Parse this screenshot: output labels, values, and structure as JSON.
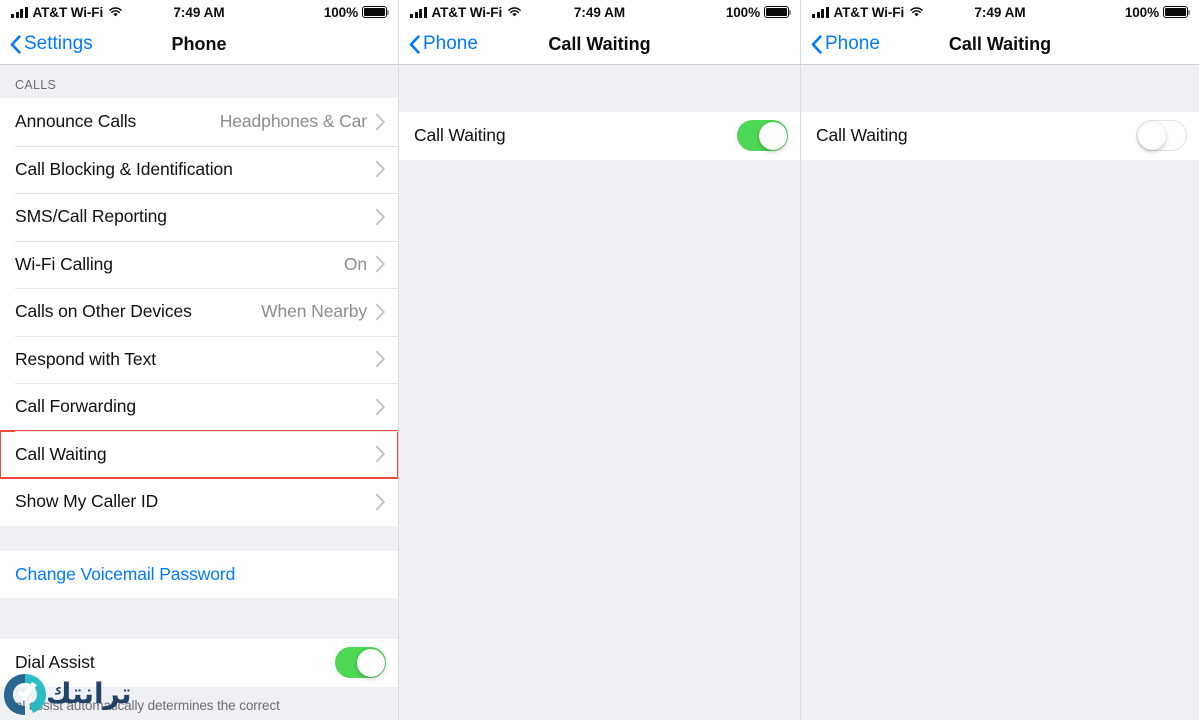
{
  "statusbar": {
    "carrier": "AT&T Wi-Fi",
    "time": "7:49 AM",
    "battery_percent": "100%",
    "signal_icon": "cellular-bars-icon",
    "wifi_icon": "wifi-icon",
    "battery_icon": "battery-full-icon"
  },
  "colors": {
    "accent_blue": "#007aff",
    "toggle_on_green": "#4cd755",
    "highlight_red": "#f04a3c",
    "value_gray": "#8c8c91",
    "group_bg": "#eff0f4"
  },
  "panel1": {
    "nav": {
      "back_label": "Settings",
      "title": "Phone",
      "back_icon": "chevron-left-icon"
    },
    "group_calls": {
      "header": "CALLS",
      "rows": [
        {
          "label": "Announce Calls",
          "value": "Headphones & Car",
          "accessory": "chevron-right-icon",
          "highlight": false
        },
        {
          "label": "Call Blocking & Identification",
          "value": "",
          "accessory": "chevron-right-icon",
          "highlight": false
        },
        {
          "label": "SMS/Call Reporting",
          "value": "",
          "accessory": "chevron-right-icon",
          "highlight": false
        },
        {
          "label": "Wi-Fi Calling",
          "value": "On",
          "accessory": "chevron-right-icon",
          "highlight": false
        },
        {
          "label": "Calls on Other Devices",
          "value": "When Nearby",
          "accessory": "chevron-right-icon",
          "highlight": false
        },
        {
          "label": "Respond with Text",
          "value": "",
          "accessory": "chevron-right-icon",
          "highlight": false
        },
        {
          "label": "Call Forwarding",
          "value": "",
          "accessory": "chevron-right-icon",
          "highlight": false
        },
        {
          "label": "Call Waiting",
          "value": "",
          "accessory": "chevron-right-icon",
          "highlight": true
        },
        {
          "label": "Show My Caller ID",
          "value": "",
          "accessory": "chevron-right-icon",
          "highlight": false
        }
      ]
    },
    "group_voicemail": {
      "link_label": "Change Voicemail Password"
    },
    "group_dial": {
      "label": "Dial Assist",
      "toggle_state": "on",
      "footer_note": "al assist automatically determines the correct"
    }
  },
  "panel2": {
    "nav": {
      "back_label": "Phone",
      "title": "Call Waiting",
      "back_icon": "chevron-left-icon"
    },
    "row": {
      "label": "Call Waiting",
      "toggle_state": "on"
    }
  },
  "panel3": {
    "nav": {
      "back_label": "Phone",
      "title": "Call Waiting",
      "back_icon": "chevron-left-icon"
    },
    "row": {
      "label": "Call Waiting",
      "toggle_state": "off"
    }
  },
  "watermark": {
    "text": "ترانتك",
    "logo_icon": "check-badge-logo-icon"
  }
}
